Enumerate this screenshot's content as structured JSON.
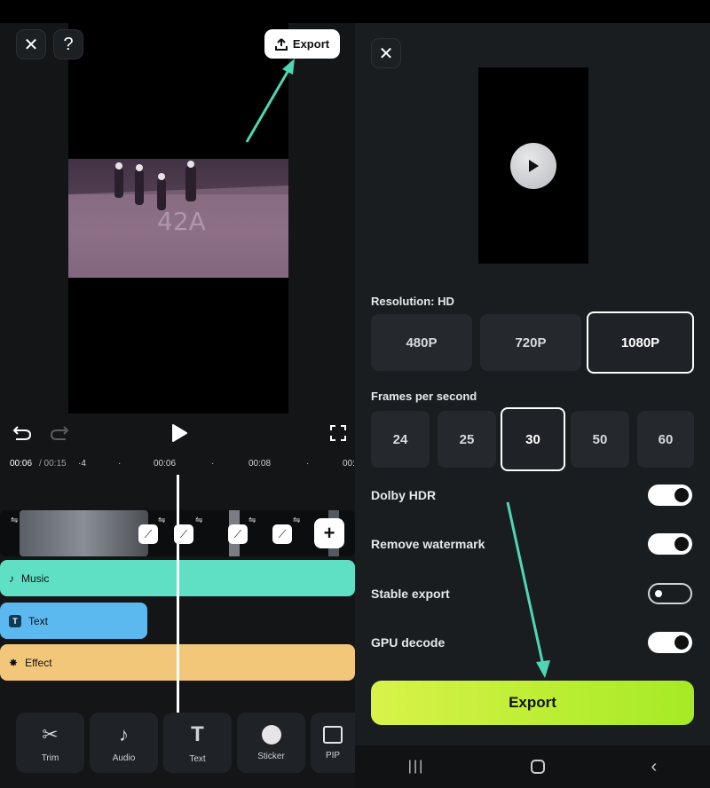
{
  "editor": {
    "export_label": "Export",
    "time_current": "00:06",
    "time_total": "/ 00:15",
    "ruler_labels": [
      "·4",
      "00:06",
      "00:08",
      "00:"
    ],
    "tracks": {
      "music": "Music",
      "text": "Text",
      "effect": "Effect"
    },
    "tools": [
      {
        "label": "Trim",
        "icon": "scissors-icon"
      },
      {
        "label": "Audio",
        "icon": "music-note-icon"
      },
      {
        "label": "Text",
        "icon": "text-icon"
      },
      {
        "label": "Sticker",
        "icon": "sticker-icon"
      },
      {
        "label": "PIP",
        "icon": "image-icon"
      }
    ],
    "colors": {
      "music": "#5fe0c4",
      "text": "#5bb9f0",
      "effect": "#f3c77a"
    }
  },
  "export_panel": {
    "resolution_label": "Resolution: HD",
    "resolutions": [
      "480P",
      "720P",
      "1080P"
    ],
    "selected_resolution": "1080P",
    "fps_label": "Frames per second",
    "fps_options": [
      "24",
      "25",
      "30",
      "50",
      "60"
    ],
    "selected_fps": "30",
    "toggles": [
      {
        "label": "Dolby HDR",
        "on": true
      },
      {
        "label": "Remove watermark",
        "on": true
      },
      {
        "label": "Stable export",
        "on": false
      },
      {
        "label": "GPU decode",
        "on": true
      }
    ],
    "export_button": "Export",
    "accent": "#c6f03a"
  }
}
